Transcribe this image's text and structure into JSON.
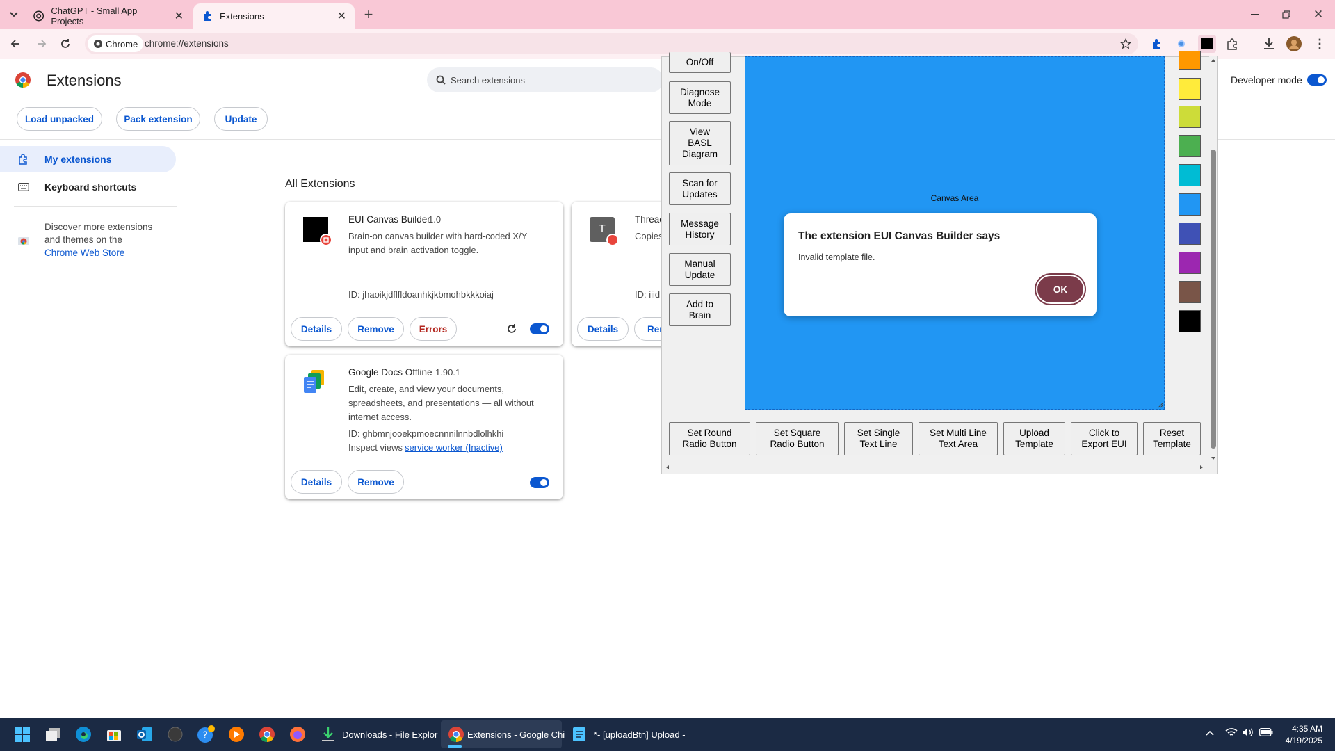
{
  "browser": {
    "tabs": [
      {
        "title": "ChatGPT - Small App Projects",
        "icon": "chatgpt-icon",
        "active": false
      },
      {
        "title": "Extensions",
        "icon": "puzzle-icon",
        "active": true
      }
    ],
    "chip_label": "Chrome",
    "url": "chrome://extensions"
  },
  "header": {
    "title": "Extensions",
    "search_placeholder": "Search extensions",
    "developer_mode_label": "Developer mode",
    "developer_mode_on": true,
    "buttons": {
      "load_unpacked": "Load unpacked",
      "pack_extension": "Pack extension",
      "update": "Update"
    }
  },
  "sidebar": {
    "items": [
      {
        "label": "My extensions",
        "icon": "extension-icon",
        "selected": true
      },
      {
        "label": "Keyboard shortcuts",
        "icon": "keyboard-icon",
        "selected": false
      }
    ],
    "discover_line1": "Discover more extensions",
    "discover_line2": "and themes on the",
    "store_link": "Chrome Web Store"
  },
  "main": {
    "section_title": "All Extensions",
    "cards": [
      {
        "name": "EUI Canvas Builder",
        "version": "1.0",
        "description_line1": "Brain-on canvas builder with hard-coded X/Y",
        "description_line2": "input and brain activation toggle.",
        "id_text": "ID: jhaoikjdflfldoanhkjkbmohbkkkoiaj",
        "buttons": [
          "Details",
          "Remove",
          "Errors"
        ],
        "enabled": true
      },
      {
        "name": "Threac",
        "desc_partial": "Copies",
        "id_partial": "ID: iiid",
        "icon_letter": "T",
        "buttons": [
          "Details",
          "Rem"
        ]
      },
      {
        "name": "Google Docs Offline",
        "version": "1.90.1",
        "description_line1": "Edit, create, and view your documents,",
        "description_line2": "spreadsheets, and presentations — all without",
        "description_line3": "internet access.",
        "id_text": "ID: ghbmnjooekpmoecnnnilnnbdlolhkhi",
        "inspect_label": "Inspect views",
        "inspect_link": "service worker (Inactive)",
        "buttons": [
          "Details",
          "Remove"
        ],
        "enabled": true
      }
    ]
  },
  "popup": {
    "side_buttons": [
      {
        "line1": "On/Off",
        "line2": "",
        "line3": ""
      },
      {
        "line1": "Diagnose",
        "line2": "Mode",
        "line3": ""
      },
      {
        "line1": "View",
        "line2": "BASL",
        "line3": "Diagram"
      },
      {
        "line1": "Scan for",
        "line2": "Updates",
        "line3": ""
      },
      {
        "line1": "Message",
        "line2": "History",
        "line3": ""
      },
      {
        "line1": "Manual",
        "line2": "Update",
        "line3": ""
      },
      {
        "line1": "Add to",
        "line2": "Brain",
        "line3": ""
      }
    ],
    "canvas_label": "Canvas Area",
    "canvas_color": "#2196f3",
    "bottom_buttons": [
      {
        "line1": "Set Round",
        "line2": "Radio Button"
      },
      {
        "line1": "Set Square",
        "line2": "Radio Button"
      },
      {
        "line1": "Set Single",
        "line2": "Text Line"
      },
      {
        "line1": "Set Multi Line",
        "line2": "Text Area"
      },
      {
        "line1": "Upload",
        "line2": "Template"
      },
      {
        "line1": "Click to",
        "line2": "Export EUI"
      },
      {
        "line1": "Reset",
        "line2": "Template"
      }
    ],
    "swatches": [
      "#ff9800",
      "#ffeb3b",
      "#cddc39",
      "#4caf50",
      "#00bcd4",
      "#2196f3",
      "#3f51b5",
      "#9c27b0",
      "#795548",
      "#000000"
    ]
  },
  "dialog": {
    "title": "The extension EUI Canvas Builder says",
    "message": "Invalid template file.",
    "ok_label": "OK"
  },
  "taskbar": {
    "apps": [
      {
        "label": "Downloads - File Explor",
        "icon": "download-icon"
      },
      {
        "label": "Extensions - Google Chi",
        "icon": "chrome-icon"
      },
      {
        "label": "*- [uploadBtn] Upload -",
        "icon": "notepad-icon"
      }
    ],
    "time": "4:35 AM",
    "date": "4/19/2025"
  }
}
